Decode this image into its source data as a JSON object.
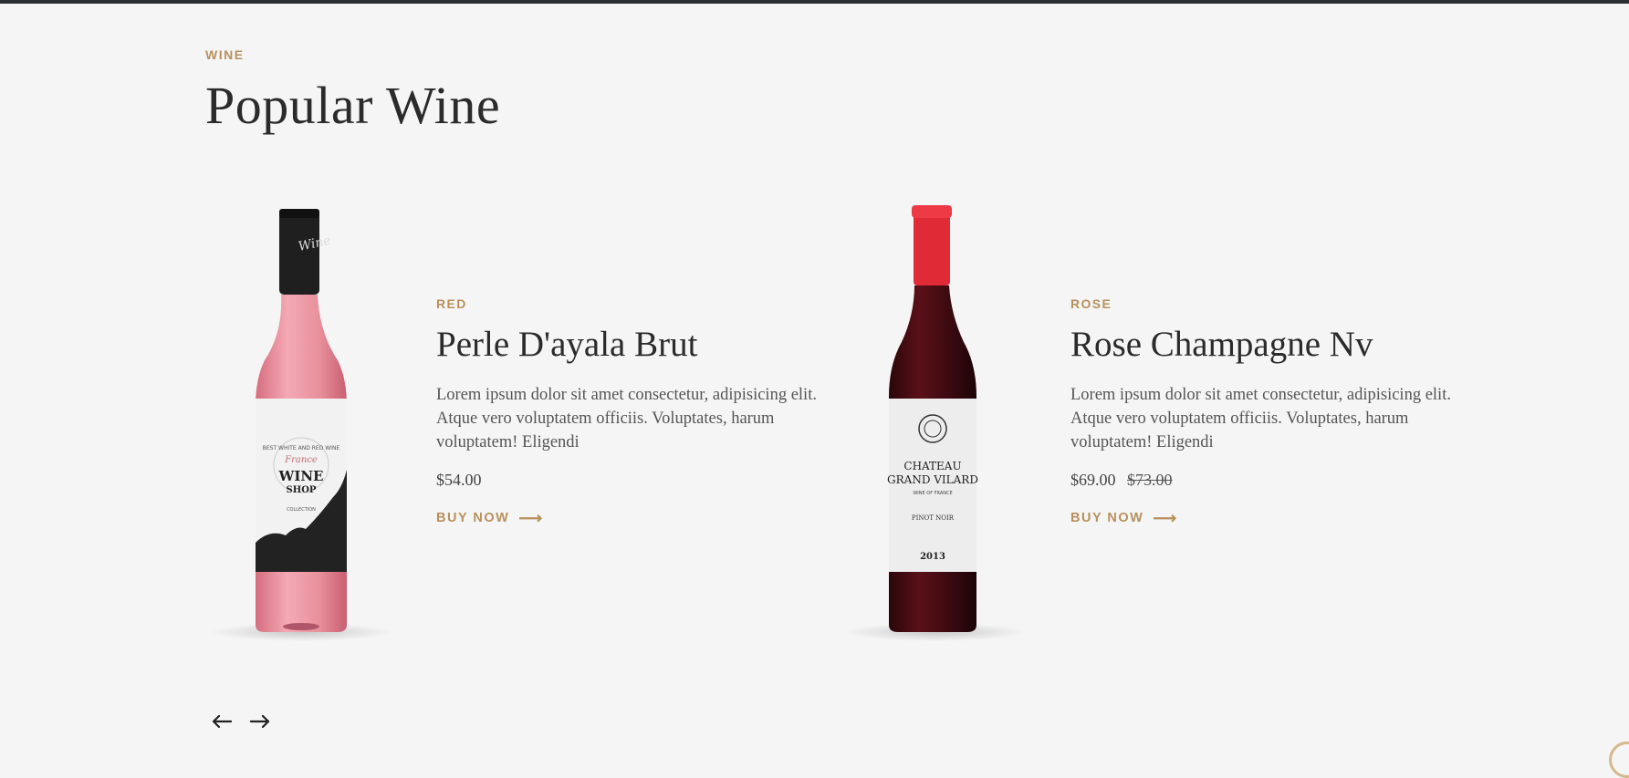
{
  "section": {
    "eyebrow": "WINE",
    "title": "Popular Wine"
  },
  "products": [
    {
      "category": "RED",
      "name": "Perle D'ayala Brut",
      "description": "Lorem ipsum dolor sit amet consectetur, adipisicing elit. Atque vero voluptatem officiis. Voluptates, harum voluptatem! Eligendi",
      "price": "$54.00",
      "old_price": "",
      "cta": "BUY NOW",
      "bottle": {
        "label_lines": [
          "BEST WHITE AND RED WINE",
          "France",
          "WINE",
          "SHOP",
          "COLLECTION"
        ],
        "neck_text": "Wine",
        "liquid_color": "#e8909c",
        "cap_color": "#1f1f1f"
      }
    },
    {
      "category": "ROSE",
      "name": "Rose Champagne Nv",
      "description": "Lorem ipsum dolor sit amet consectetur, adipisicing elit. Atque vero voluptatem officiis. Voluptates, harum voluptatem! Eligendi",
      "price": "$69.00",
      "old_price": "$73.00",
      "cta": "BUY NOW",
      "bottle": {
        "label_lines": [
          "CHATEAU",
          "GRAND VILARD",
          "WINE OF FRANCE",
          "PINOT NOIR",
          "2013"
        ],
        "liquid_color": "#3a0a10",
        "cap_color": "#e02b36"
      }
    }
  ],
  "navigation": {
    "prev_icon": "arrow-left-icon",
    "next_icon": "arrow-right-icon"
  },
  "colors": {
    "accent": "#b8905d",
    "background": "#f5f5f5",
    "text": "#2b2b2b"
  }
}
